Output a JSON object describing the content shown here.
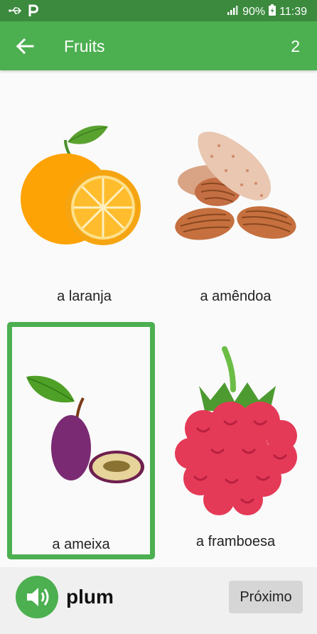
{
  "status_bar": {
    "battery": "90%",
    "time": "11:39",
    "icons": [
      "usb-icon",
      "p-app-icon",
      "signal-icon",
      "battery-charging-icon"
    ]
  },
  "app_bar": {
    "title": "Fruits",
    "counter": "2",
    "back_icon": "arrow-left-icon"
  },
  "cards": [
    {
      "label": "a laranja",
      "image": "orange"
    },
    {
      "label": "a amêndoa",
      "image": "almond"
    },
    {
      "label": "a ameixa",
      "image": "plum",
      "selected": true
    },
    {
      "label": "a framboesa",
      "image": "raspberry"
    }
  ],
  "bottom_bar": {
    "word": "plum",
    "next_label": "Próximo",
    "speaker_icon": "speaker-icon"
  },
  "colors": {
    "status_bar": "#3b8a3e",
    "app_bar": "#4caf50",
    "selection": "#4caf50",
    "next_button": "#d6d6d6"
  }
}
